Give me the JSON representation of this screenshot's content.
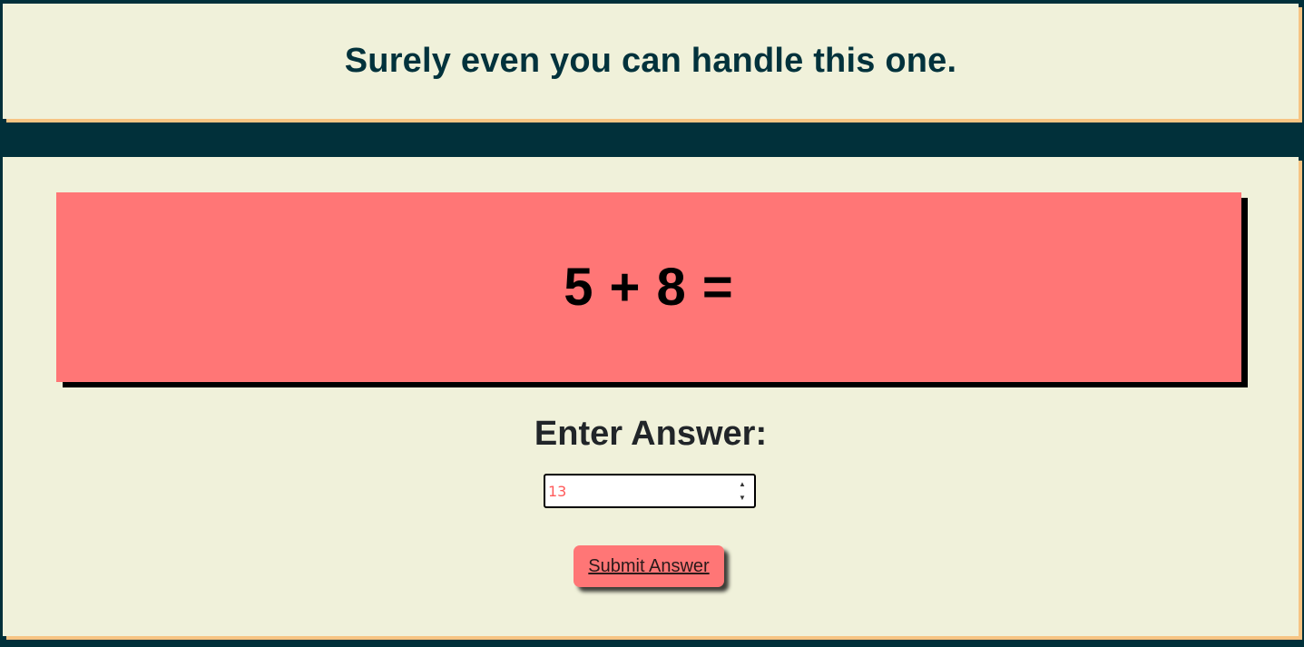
{
  "header": {
    "title": "Surely even you can handle this one."
  },
  "question": {
    "text": "5 + 8 ="
  },
  "answer": {
    "label": "Enter Answer:",
    "value": "13",
    "spinner_up_icon": "triangle-up-icon",
    "spinner_down_icon": "triangle-down-icon"
  },
  "submit": {
    "label": "Submit Answer"
  },
  "colors": {
    "background": "#01303a",
    "panel": "#f0f1da",
    "panel_shadow": "#f7c483",
    "accent": "#ff7676",
    "title_text": "#02323c"
  }
}
